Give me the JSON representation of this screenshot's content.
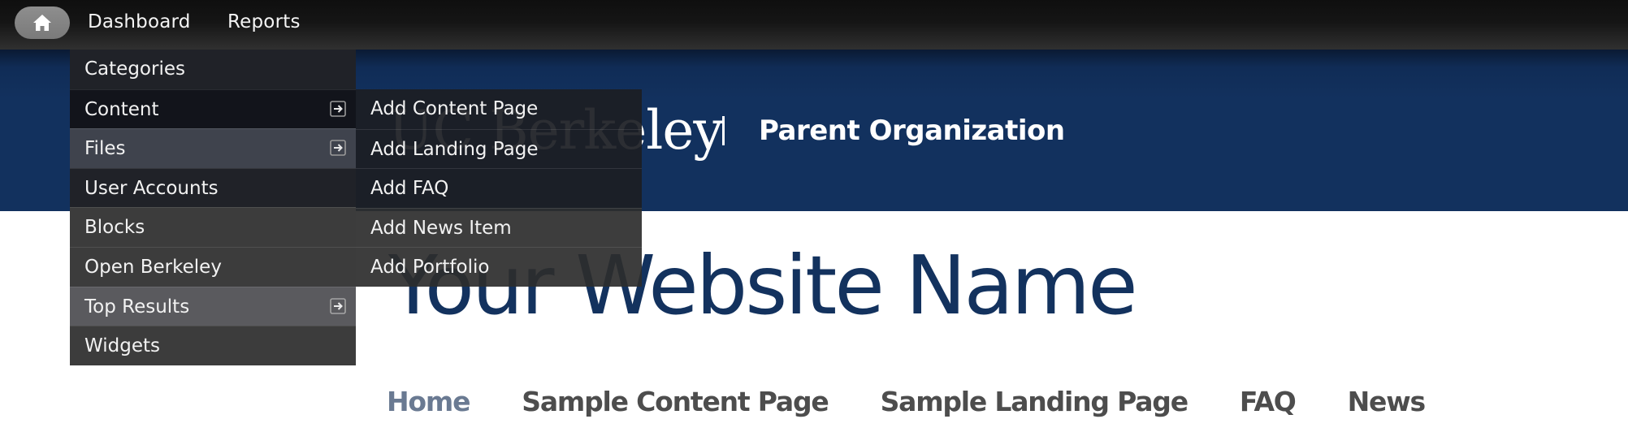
{
  "toolbar": {
    "home_icon": "home-icon",
    "links": [
      {
        "label": "Dashboard"
      },
      {
        "label": "Reports"
      }
    ]
  },
  "header": {
    "logo_text": "UC Berkeley",
    "separator": "|",
    "parent_org": "Parent Organization",
    "background_color": "#12315e"
  },
  "site": {
    "title": "Your Website Name",
    "title_color": "#13325e"
  },
  "main_nav": {
    "items": [
      {
        "label": "Home",
        "active": true
      },
      {
        "label": "Sample Content Page",
        "active": false
      },
      {
        "label": "Sample Landing Page",
        "active": false
      },
      {
        "label": "FAQ",
        "active": false
      },
      {
        "label": "News",
        "active": false
      }
    ]
  },
  "dashboard_menu": {
    "items": [
      {
        "label": "Categories",
        "has_submenu": false
      },
      {
        "label": "Content",
        "has_submenu": true,
        "expanded": true
      },
      {
        "label": "Files",
        "has_submenu": true
      },
      {
        "label": "User Accounts",
        "has_submenu": false
      },
      {
        "label": "Blocks",
        "has_submenu": false
      },
      {
        "label": "Open Berkeley",
        "has_submenu": false
      },
      {
        "label": "Top Results",
        "has_submenu": true
      },
      {
        "label": "Widgets",
        "has_submenu": false
      }
    ],
    "submenu_icon": "arrow-right-box-icon"
  },
  "content_submenu": {
    "items": [
      {
        "label": "Add Content Page"
      },
      {
        "label": "Add Landing Page"
      },
      {
        "label": "Add FAQ"
      },
      {
        "label": "Add News Item"
      },
      {
        "label": "Add Portfolio"
      }
    ]
  }
}
